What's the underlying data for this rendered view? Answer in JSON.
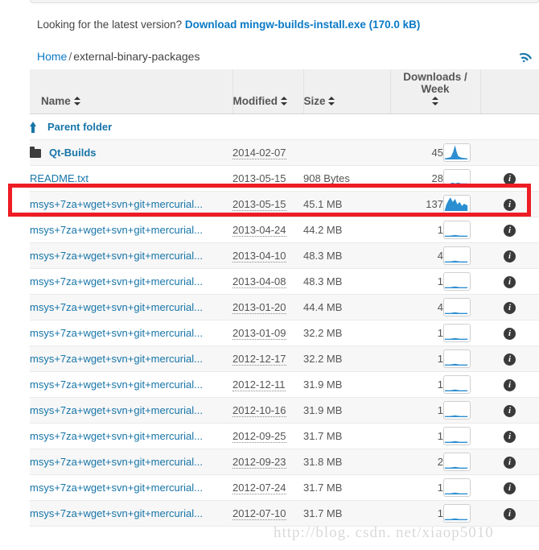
{
  "top_notice": {
    "prefix": "Looking for the latest version?",
    "download_link": "Download mingw-builds-install.exe (170.0 kB)"
  },
  "breadcrumb": {
    "home": "Home",
    "separator": "/",
    "current": "external-binary-packages",
    "rss_icon": "rss-icon"
  },
  "table": {
    "columns": {
      "name": "Name",
      "modified": "Modified",
      "size": "Size",
      "downloads": "Downloads / Week"
    },
    "parent_row": {
      "label": "Parent folder",
      "icon": "up-arrow-icon"
    },
    "rows": [
      {
        "name": "Qt-Builds",
        "type": "folder",
        "modified": "2014-02-07",
        "size": "",
        "downloads": "45",
        "sparkline": "peak",
        "info": true,
        "show_info": false
      },
      {
        "name": "README.txt",
        "type": "file",
        "modified": "2013-05-15",
        "size": "908 Bytes",
        "downloads": "28",
        "sparkline": "low-bump",
        "show_info": true
      },
      {
        "name": "msys+7za+wget+svn+git+mercurial...",
        "type": "file",
        "modified": "2013-05-15",
        "size": "45.1 MB",
        "downloads": "137",
        "sparkline": "filled-high",
        "show_info": true,
        "highlighted": true
      },
      {
        "name": "msys+7za+wget+svn+git+mercurial...",
        "type": "file",
        "modified": "2013-04-24",
        "size": "44.2 MB",
        "downloads": "1",
        "sparkline": "flat",
        "show_info": true
      },
      {
        "name": "msys+7za+wget+svn+git+mercurial...",
        "type": "file",
        "modified": "2013-04-10",
        "size": "48.3 MB",
        "downloads": "4",
        "sparkline": "flat",
        "show_info": true
      },
      {
        "name": "msys+7za+wget+svn+git+mercurial...",
        "type": "file",
        "modified": "2013-04-08",
        "size": "48.3 MB",
        "downloads": "1",
        "sparkline": "flat",
        "show_info": true
      },
      {
        "name": "msys+7za+wget+svn+git+mercurial...",
        "type": "file",
        "modified": "2013-01-20",
        "size": "44.4 MB",
        "downloads": "4",
        "sparkline": "flat",
        "show_info": true
      },
      {
        "name": "msys+7za+wget+svn+git+mercurial...",
        "type": "file",
        "modified": "2013-01-09",
        "size": "32.2 MB",
        "downloads": "1",
        "sparkline": "flat",
        "show_info": true
      },
      {
        "name": "msys+7za+wget+svn+git+mercurial...",
        "type": "file",
        "modified": "2012-12-17",
        "size": "32.2 MB",
        "downloads": "1",
        "sparkline": "flat",
        "show_info": true
      },
      {
        "name": "msys+7za+wget+svn+git+mercurial...",
        "type": "file",
        "modified": "2012-12-11",
        "size": "31.9 MB",
        "downloads": "1",
        "sparkline": "flat",
        "show_info": true
      },
      {
        "name": "msys+7za+wget+svn+git+mercurial...",
        "type": "file",
        "modified": "2012-10-16",
        "size": "31.9 MB",
        "downloads": "1",
        "sparkline": "flat",
        "show_info": true
      },
      {
        "name": "msys+7za+wget+svn+git+mercurial...",
        "type": "file",
        "modified": "2012-09-25",
        "size": "31.7 MB",
        "downloads": "1",
        "sparkline": "flat",
        "show_info": true
      },
      {
        "name": "msys+7za+wget+svn+git+mercurial...",
        "type": "file",
        "modified": "2012-09-23",
        "size": "31.8 MB",
        "downloads": "2",
        "sparkline": "flat",
        "show_info": true
      },
      {
        "name": "msys+7za+wget+svn+git+mercurial...",
        "type": "file",
        "modified": "2012-07-24",
        "size": "31.7 MB",
        "downloads": "1",
        "sparkline": "flat",
        "show_info": true
      },
      {
        "name": "msys+7za+wget+svn+git+mercurial...",
        "type": "file",
        "modified": "2012-07-10",
        "size": "31.7 MB",
        "downloads": "1",
        "sparkline": "flat",
        "show_info": true
      }
    ]
  },
  "annotation": {
    "highlight_color": "#ee1c25",
    "highlight_row_index": 2
  },
  "watermark": "http://blog. csdn. net/xiaop5010",
  "colors": {
    "link": "#1775a8",
    "download_link": "#0a7ac6",
    "sparkline": "#2c8fd1",
    "header_bg": "#f0f0f0",
    "row_alt_bg": "#f7f7f7"
  }
}
